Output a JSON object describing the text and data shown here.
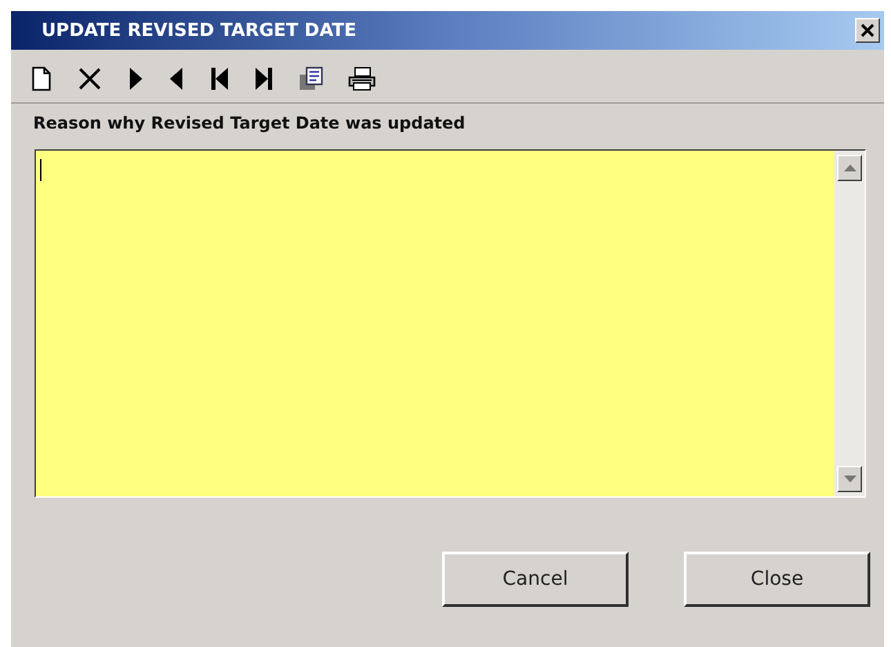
{
  "window": {
    "title": "UPDATE REVISED TARGET DATE"
  },
  "reason": {
    "label": "Reason why Revised Target Date was updated"
  },
  "buttons": [
    {
      "label": "Cancel"
    },
    {
      "label": "Close"
    }
  ]
}
